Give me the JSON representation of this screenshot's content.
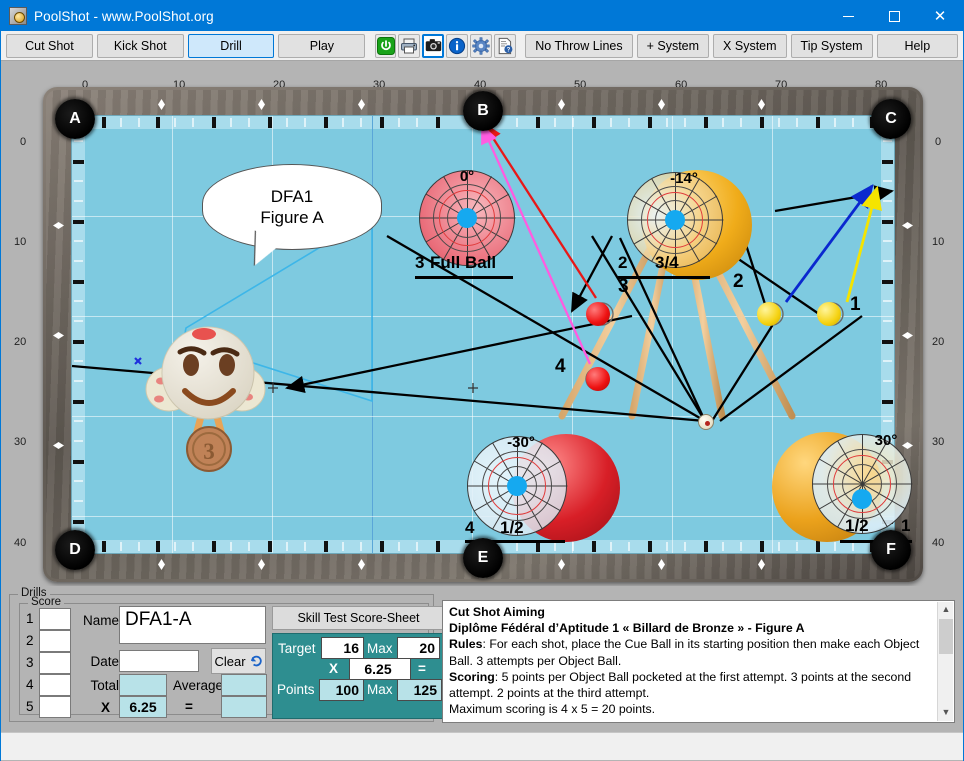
{
  "window": {
    "title": "PoolShot - www.PoolShot.org",
    "icon": "app-icon",
    "minimize": "—",
    "maximize": "☐",
    "close": "✕"
  },
  "toolbar": {
    "mode_buttons": [
      {
        "label": "Cut Shot",
        "active": false
      },
      {
        "label": "Kick Shot",
        "active": false
      },
      {
        "label": "Drill",
        "active": true
      },
      {
        "label": "Play",
        "active": false
      }
    ],
    "icon_buttons": [
      {
        "name": "power-icon",
        "glyph": "⏻",
        "color": "#19a319",
        "selected": false
      },
      {
        "name": "printer-icon",
        "glyph": "⎙",
        "color": "#4a6078",
        "selected": false
      },
      {
        "name": "camera-icon",
        "glyph": "■",
        "color": "#1c1c1c",
        "selected": true
      },
      {
        "name": "info-icon",
        "glyph": "i",
        "color": "#0a63c9",
        "selected": false
      },
      {
        "name": "gear-icon",
        "glyph": "⚙",
        "color": "#4f7bbd",
        "selected": false
      },
      {
        "name": "help-doc-icon",
        "glyph": "?",
        "color": "#2b5fa8",
        "selected": false
      }
    ],
    "system_buttons": [
      {
        "label": "No Throw Lines"
      },
      {
        "label": "+ System"
      },
      {
        "label": "X System"
      },
      {
        "label": "Tip System"
      },
      {
        "label": "Help"
      }
    ]
  },
  "table": {
    "top_ruler": [
      "0",
      "10",
      "20",
      "30",
      "40",
      "50",
      "60",
      "70",
      "80"
    ],
    "left_ruler": [
      "0",
      "10",
      "20",
      "30",
      "40"
    ],
    "right_ruler": [
      "0",
      "10",
      "20",
      "30",
      "40"
    ],
    "pockets": [
      {
        "id": "A",
        "label": "A"
      },
      {
        "id": "B",
        "label": "B"
      },
      {
        "id": "C",
        "label": "C"
      },
      {
        "id": "D",
        "label": "D"
      },
      {
        "id": "E",
        "label": "E"
      },
      {
        "id": "F",
        "label": "F"
      }
    ],
    "speech_bubble": {
      "line1": "DFA1",
      "line2": "Figure A"
    },
    "mascot": {
      "name": "mascot-cue-ball",
      "medal": "3"
    },
    "aim_targets": [
      {
        "name": "aim-target-3",
        "angle": "0°",
        "number": "3",
        "fraction": "Full Ball",
        "ball_color": "#e8606e"
      },
      {
        "name": "aim-target-2",
        "angle": "-14°",
        "number": "2",
        "fraction": "3/4",
        "ball_color": "#f0ac1a"
      },
      {
        "name": "aim-target-4",
        "angle": "-30°",
        "number": "4",
        "fraction": "1/2",
        "ball_color": "#d81f27"
      },
      {
        "name": "aim-target-1",
        "angle": "30°",
        "number": "1",
        "fraction": "1/2",
        "ball_color": "#eba21c"
      }
    ],
    "object_balls": [
      {
        "label": "1",
        "color": "#f5d211"
      },
      {
        "label": "2",
        "color": "#f5d211"
      },
      {
        "label": "3",
        "color": "#ee1111"
      },
      {
        "label": "4",
        "color": "#ee1111"
      }
    ]
  },
  "drill_panel": {
    "group_title": "Drills",
    "score_title": "Score",
    "rows": [
      "1",
      "2",
      "3",
      "4",
      "5"
    ],
    "name_label": "Name",
    "name_value": "DFA1-A",
    "date_label": "Date",
    "date_value": "",
    "total_label": "Total",
    "total_value": "",
    "average_label": "Average",
    "average_value": "",
    "clear_label": "Clear",
    "multiply_label": "X",
    "multiplier_value": "6.25",
    "equals_label": "=",
    "result_value": "",
    "score_sheet_button": "Skill Test Score-Sheet",
    "target_label": "Target",
    "target_value": "16",
    "target_max_label": "Max",
    "target_max_value": "20",
    "factor_x_label": "X",
    "factor_value": "6.25",
    "factor_equals": "=",
    "points_label": "Points",
    "points_value": "100",
    "points_max_label": "Max",
    "points_max_value": "125"
  },
  "description": {
    "title": "Cut Shot Aiming",
    "subtitle": "Diplôme Fédéral d’Aptitude 1 « Billard de Bronze » - Figure A",
    "rules_label": "Rules",
    "rules_text": ": For each shot, place the Cue Ball in its starting position then make each Object Ball. 3 attempts per Object Ball.",
    "scoring_label": "Scoring",
    "scoring_text": ": 5 points per Object Ball pocketed at the first attempt. 3 points at the second attempt. 2 points at the third attempt.",
    "max_text": "Maximum scoring is 4 x 5 = 20 points."
  },
  "colors": {
    "accent": "#0078d7",
    "cloth": "#7ecae0",
    "teal_panel": "#2e8e90",
    "cyan_field": "#b8e2e8"
  }
}
